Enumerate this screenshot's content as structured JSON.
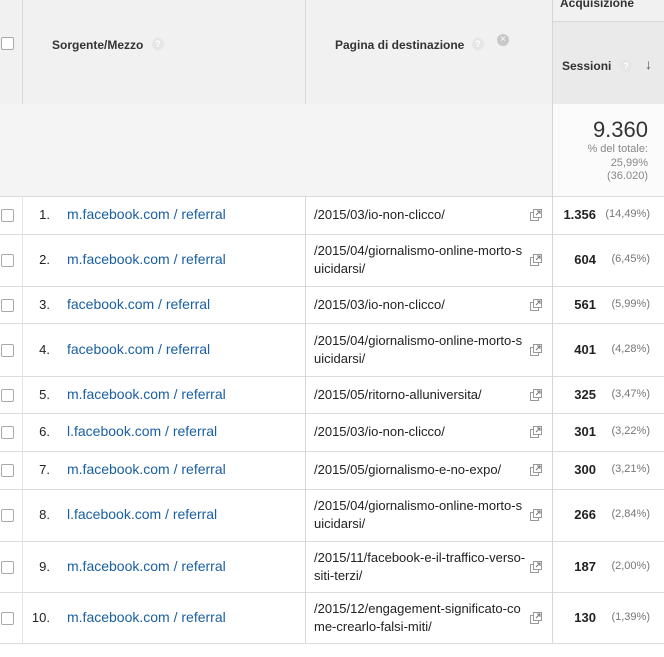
{
  "header": {
    "group_label": "Acquisizione",
    "col_source": "Sorgente/Mezzo",
    "col_page": "Pagina di destinazione",
    "col_sessions": "Sessioni",
    "help_glyph": "?",
    "clear_glyph": "×",
    "sort_glyph": "↓"
  },
  "totals": {
    "sessions": "9.360",
    "pct_label": "% del totale:",
    "pct_value": "25,99%",
    "total_value": "(36.020)"
  },
  "rows": [
    {
      "index": "1.",
      "source": "m.facebook.com / referral",
      "page": "/2015/03/io-non-clicco/",
      "sessions": "1.356",
      "pct": "(14,49%)"
    },
    {
      "index": "2.",
      "source": "m.facebook.com / referral",
      "page": "/2015/04/giornalismo-online-morto-suicidarsi/",
      "sessions": "604",
      "pct": "(6,45%)"
    },
    {
      "index": "3.",
      "source": "facebook.com / referral",
      "page": "/2015/03/io-non-clicco/",
      "sessions": "561",
      "pct": "(5,99%)"
    },
    {
      "index": "4.",
      "source": "facebook.com / referral",
      "page": "/2015/04/giornalismo-online-morto-suicidarsi/",
      "sessions": "401",
      "pct": "(4,28%)"
    },
    {
      "index": "5.",
      "source": "m.facebook.com / referral",
      "page": "/2015/05/ritorno-alluniversita/",
      "sessions": "325",
      "pct": "(3,47%)"
    },
    {
      "index": "6.",
      "source": "l.facebook.com / referral",
      "page": "/2015/03/io-non-clicco/",
      "sessions": "301",
      "pct": "(3,22%)"
    },
    {
      "index": "7.",
      "source": "m.facebook.com / referral",
      "page": "/2015/05/giornalismo-e-no-expo/",
      "sessions": "300",
      "pct": "(3,21%)"
    },
    {
      "index": "8.",
      "source": "l.facebook.com / referral",
      "page": "/2015/04/giornalismo-online-morto-suicidarsi/",
      "sessions": "266",
      "pct": "(2,84%)"
    },
    {
      "index": "9.",
      "source": "m.facebook.com / referral",
      "page": "/2015/11/facebook-e-il-traffico-verso-siti-terzi/",
      "sessions": "187",
      "pct": "(2,00%)"
    },
    {
      "index": "10.",
      "source": "m.facebook.com / referral",
      "page": "/2015/12/engagement-significato-come-crearlo-falsi-miti/",
      "sessions": "130",
      "pct": "(1,39%)"
    }
  ],
  "colors": {
    "link": "#1a5fa2",
    "header_bg": "#f1f1f1",
    "total_bg": "#f4f4f4"
  }
}
